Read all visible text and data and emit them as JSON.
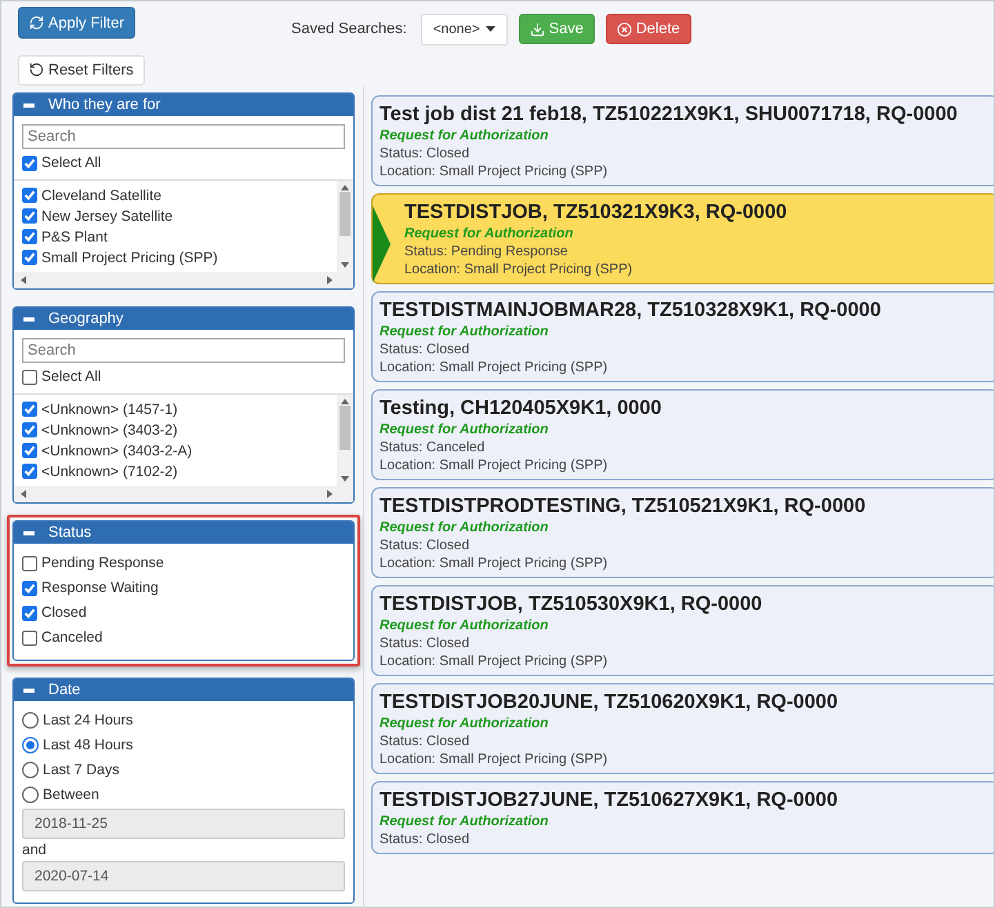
{
  "toolbar": {
    "apply_button": "Apply Filter",
    "saved_label": "Saved Searches:",
    "saved_select": "<none>",
    "save_button": "Save",
    "delete_button": "Delete",
    "reset_button": "Reset Filters"
  },
  "filters": [
    {
      "kind": "checklist",
      "title": "Who they are for",
      "highlighted": false,
      "search_placeholder": "Search",
      "select_all": {
        "label": "Select All",
        "checked": true
      },
      "items": [
        {
          "label": "Cleveland Satellite",
          "checked": true
        },
        {
          "label": "New Jersey Satellite",
          "checked": true
        },
        {
          "label": "P&S Plant",
          "checked": true
        },
        {
          "label": "Small Project Pricing (SPP)",
          "checked": true
        }
      ]
    },
    {
      "kind": "checklist",
      "title": "Geography",
      "highlighted": false,
      "search_placeholder": "Search",
      "select_all": {
        "label": "Select All",
        "checked": false
      },
      "items": [
        {
          "label": "<Unknown> (1457-1)",
          "checked": true
        },
        {
          "label": "<Unknown> (3403-2)",
          "checked": true
        },
        {
          "label": "<Unknown> (3403-2-A)",
          "checked": true
        },
        {
          "label": "<Unknown> (7102-2)",
          "checked": true
        }
      ]
    },
    {
      "kind": "checks",
      "title": "Status",
      "highlighted": true,
      "items": [
        {
          "label": "Pending Response",
          "checked": false
        },
        {
          "label": "Response Waiting",
          "checked": true
        },
        {
          "label": "Closed",
          "checked": true
        },
        {
          "label": "Canceled",
          "checked": false
        }
      ]
    },
    {
      "kind": "radios",
      "title": "Date",
      "highlighted": false,
      "options": [
        {
          "label": "Last 24 Hours",
          "selected": false
        },
        {
          "label": "Last 48 Hours",
          "selected": true
        },
        {
          "label": "Last 7 Days",
          "selected": false
        },
        {
          "label": "Between",
          "selected": false
        }
      ],
      "from": "2018-11-25",
      "and_label": "and",
      "to": "2020-07-14"
    }
  ],
  "results": [
    {
      "title": "Test job dist 21 feb18, TZ510221X9K1, SHU0071718, RQ-0000",
      "type": "Request for Authorization",
      "status": "Status: Closed",
      "location": "Location: Small Project Pricing (SPP)",
      "selected": false
    },
    {
      "title": "TESTDISTJOB, TZ510321X9K3, RQ-0000",
      "type": "Request for Authorization",
      "status": "Status: Pending Response",
      "location": "Location: Small Project Pricing (SPP)",
      "selected": true
    },
    {
      "title": "TESTDISTMAINJOBMAR28, TZ510328X9K1, RQ-0000",
      "type": "Request for Authorization",
      "status": "Status: Closed",
      "location": "Location: Small Project Pricing (SPP)",
      "selected": false
    },
    {
      "title": "Testing, CH120405X9K1, 0000",
      "type": "Request for Authorization",
      "status": "Status: Canceled",
      "location": "Location: Small Project Pricing (SPP)",
      "selected": false
    },
    {
      "title": "TESTDISTPRODTESTING, TZ510521X9K1, RQ-0000",
      "type": "Request for Authorization",
      "status": "Status: Closed",
      "location": "Location: Small Project Pricing (SPP)",
      "selected": false
    },
    {
      "title": "TESTDISTJOB, TZ510530X9K1, RQ-0000",
      "type": "Request for Authorization",
      "status": "Status: Closed",
      "location": "Location: Small Project Pricing (SPP)",
      "selected": false
    },
    {
      "title": "TESTDISTJOB20JUNE, TZ510620X9K1, RQ-0000",
      "type": "Request for Authorization",
      "status": "Status: Closed",
      "location": "Location: Small Project Pricing (SPP)",
      "selected": false
    },
    {
      "title": "TESTDISTJOB27JUNE, TZ510627X9K1, RQ-0000",
      "type": "Request for Authorization",
      "status": "Status: Closed",
      "selected": false
    }
  ]
}
